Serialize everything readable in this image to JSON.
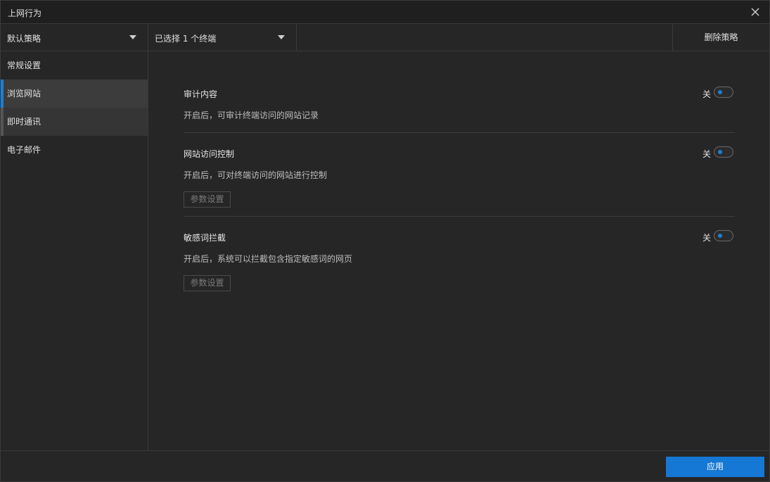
{
  "window": {
    "title": "上网行为"
  },
  "toolbar": {
    "policy_dropdown": "默认策略",
    "terminal_dropdown": "已选择 1 个终端",
    "delete_label": "删除策略"
  },
  "sidebar": {
    "items": [
      {
        "label": "常规设置"
      },
      {
        "label": "浏览网站"
      },
      {
        "label": "即时通讯"
      },
      {
        "label": "电子邮件"
      }
    ]
  },
  "sections": [
    {
      "title": "审计内容",
      "description": "开启后，可审计终端访问的网站记录",
      "toggle_label": "关"
    },
    {
      "title": "网站访问控制",
      "description": "开启后，可对终端访问的网站进行控制",
      "toggle_label": "关",
      "param_button": "参数设置"
    },
    {
      "title": "敏感词拦截",
      "description": "开启后，系统可以拦截包含指定敏感词的网页",
      "toggle_label": "关",
      "param_button": "参数设置"
    }
  ],
  "footer": {
    "apply_label": "应用"
  },
  "colors": {
    "accent": "#1478d4",
    "background": "#262626"
  }
}
